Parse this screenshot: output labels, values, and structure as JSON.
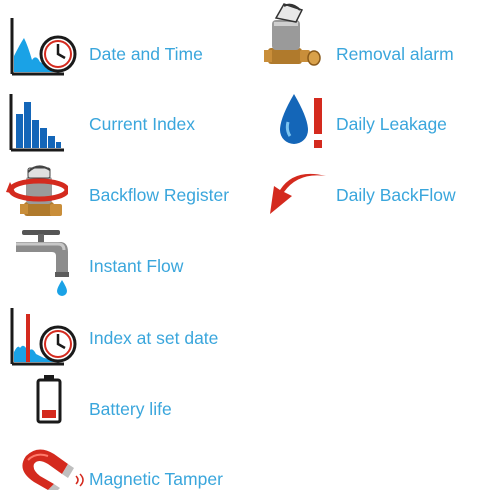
{
  "legend": {
    "left_items": [
      {
        "label": "Date and Time",
        "icon": "date-time-icon"
      },
      {
        "label": "Current Index",
        "icon": "bar-chart-icon"
      },
      {
        "label": "Backflow Register",
        "icon": "backflow-meter-icon"
      },
      {
        "label": "Instant Flow",
        "icon": "faucet-icon"
      },
      {
        "label": "Index at set date",
        "icon": "index-set-date-icon"
      },
      {
        "label": "Battery life",
        "icon": "battery-icon"
      },
      {
        "label": "Magnetic Tamper",
        "icon": "magnet-icon"
      }
    ],
    "right_items": [
      {
        "label": "Removal alarm",
        "icon": "water-meter-icon"
      },
      {
        "label": "Daily Leakage",
        "icon": "drop-alert-icon"
      },
      {
        "label": "Daily BackFlow",
        "icon": "red-arrow-icon"
      }
    ]
  },
  "colors": {
    "label": "#3aa6dc",
    "blue": "#0d5aa8",
    "red": "#d42a1e",
    "dark": "#1a1a1a"
  }
}
